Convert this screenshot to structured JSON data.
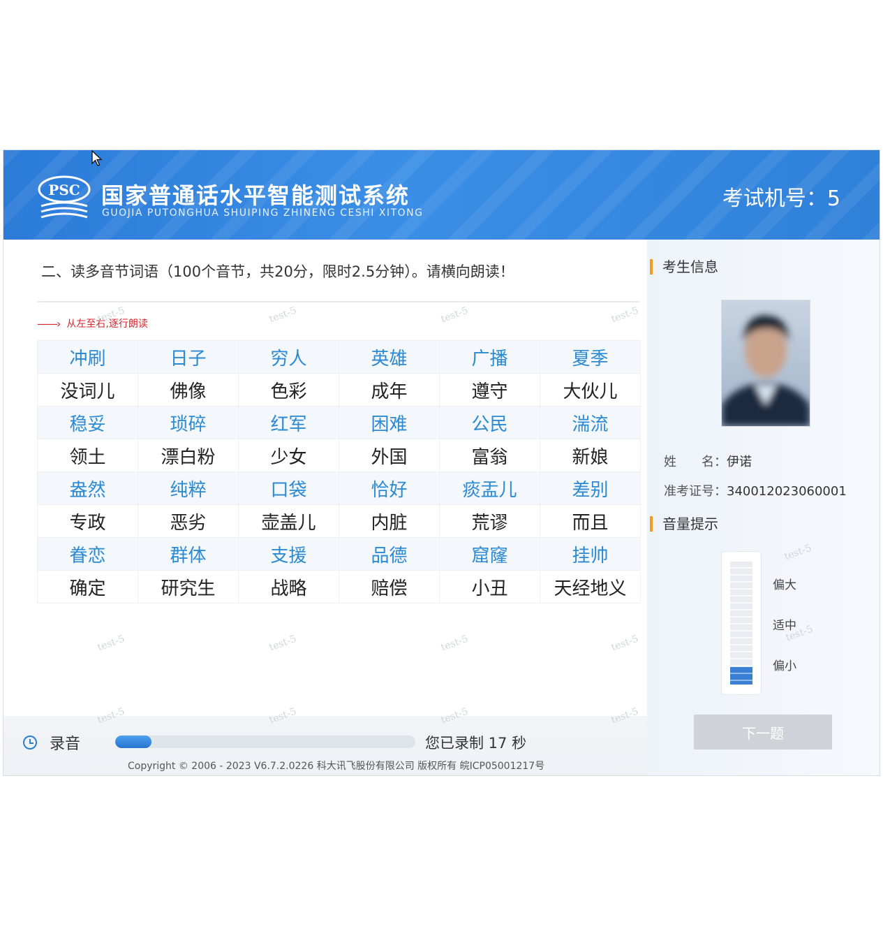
{
  "header": {
    "logo_text": "PSC",
    "title": "国家普通话水平智能测试系统",
    "subtitle": "GUOJIA PUTONGHUA SHUIPING ZHINENG CESHI XITONG",
    "machine_label": "考试机号：5"
  },
  "question": {
    "text": "二、读多音节词语（100个音节，共20分，限时2.5分钟）。请横向朗读！",
    "hint": "从左至右,逐行朗读"
  },
  "words": [
    [
      "冲刷",
      "日子",
      "穷人",
      "英雄",
      "广播",
      "夏季"
    ],
    [
      "没词儿",
      "佛像",
      "色彩",
      "成年",
      "遵守",
      "大伙儿"
    ],
    [
      "稳妥",
      "琐碎",
      "红军",
      "困难",
      "公民",
      "湍流"
    ],
    [
      "领土",
      "漂白粉",
      "少女",
      "外国",
      "富翁",
      "新娘"
    ],
    [
      "盎然",
      "纯粹",
      "口袋",
      "恰好",
      "痰盂儿",
      "差别"
    ],
    [
      "专政",
      "恶劣",
      "壶盖儿",
      "内脏",
      "荒谬",
      "而且"
    ],
    [
      "眷恋",
      "群体",
      "支援",
      "品德",
      "窟窿",
      "挂帅"
    ],
    [
      "确定",
      "研究生",
      "战略",
      "赔偿",
      "小丑",
      "天经地义"
    ]
  ],
  "watermark": "test-5",
  "recording": {
    "label": "录音",
    "progress": 0.12,
    "status": "您已录制 17 秒"
  },
  "copyright": "Copyright © 2006 - 2023 V6.7.2.0226 科大讯飞股份有限公司 版权所有 皖ICP05001217号",
  "sidebar": {
    "examinee_title": "考生信息",
    "name_label": "姓　　名：",
    "name_value": "伊诺",
    "id_label": "准考证号：",
    "id_value": "340012023060001",
    "volume_title": "音量提示",
    "volume_high": "偏大",
    "volume_mid": "适中",
    "volume_low": "偏小",
    "volume_level": 0.14,
    "next_button": "下一题"
  },
  "colors": {
    "header_blue": "#2f80d8",
    "word_blue": "#2a8ad4",
    "accent_orange": "#f39a1f",
    "hint_red": "#d9242b"
  }
}
